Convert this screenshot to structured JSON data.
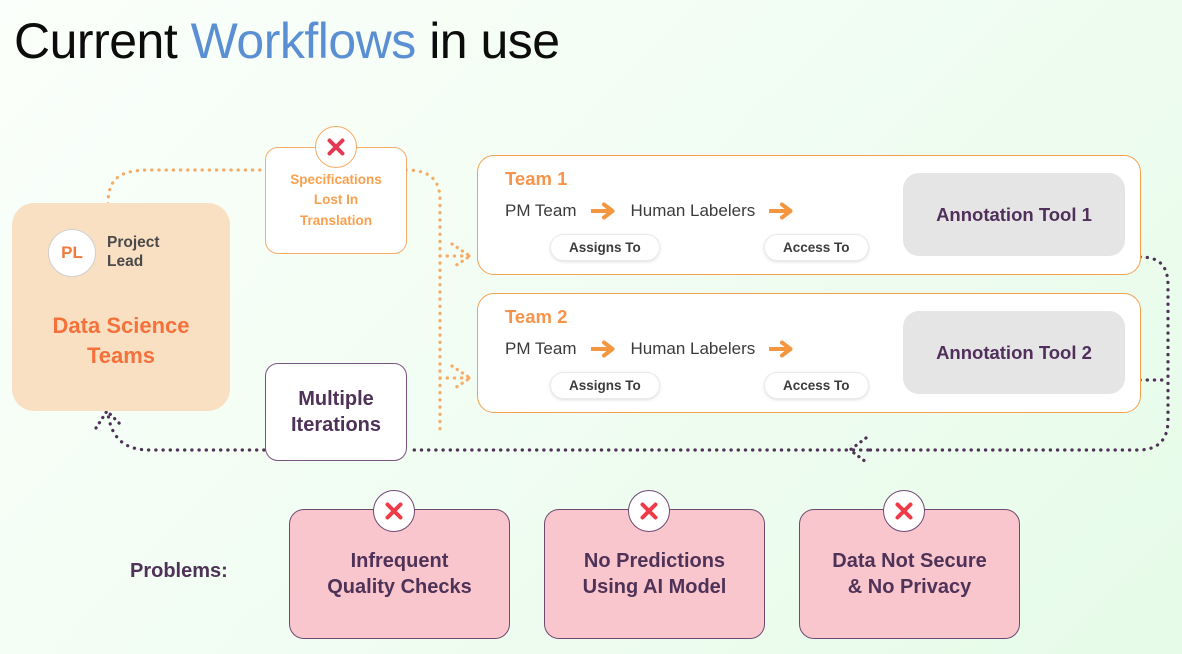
{
  "slide": {
    "title_prefix": "Current ",
    "title_highlight": "Workflows",
    "title_suffix": " in use",
    "highlight_color": "#5b8fd4"
  },
  "data_science": {
    "avatar_initials": "PL",
    "avatar_role": "Project\nLead",
    "avatar_role_line1": "Project",
    "avatar_role_line2": "Lead",
    "title_line1": "Data Science",
    "title_line2": "Teams",
    "box_color": "#fae0c3",
    "text_color": "#f4713c"
  },
  "spec_note": {
    "line1": "Specifications",
    "line2": "Lost In",
    "line3": "Translation",
    "icon": "x-icon",
    "text_color": "#f9a04f",
    "border_color": "#f6ac67"
  },
  "iterations_note": {
    "line1": "Multiple",
    "line2": "Iterations",
    "text_color": "#4f3257",
    "border_color": "#7a5480"
  },
  "teams": [
    {
      "name": "Team 1",
      "source": "PM Team",
      "target": "Human Labelers",
      "source_pill": "Assigns To",
      "target_pill": "Access To",
      "tool": "Annotation Tool 1"
    },
    {
      "name": "Team 2",
      "source": "PM Team",
      "target": "Human Labelers",
      "source_pill": "Assigns To",
      "target_pill": "Access To",
      "tool": "Annotation Tool 2"
    }
  ],
  "problems": {
    "label": "Problems:",
    "items": [
      {
        "line1": "Infrequent",
        "line2": "Quality Checks",
        "icon": "x-icon"
      },
      {
        "line1": "No Predictions",
        "line2": "Using AI Model",
        "icon": "x-icon"
      },
      {
        "line1": "Data Not Secure",
        "line2": "& No Privacy",
        "icon": "x-icon"
      }
    ],
    "card_color": "#f9c6ce",
    "border_color": "#6d4a72",
    "text_color": "#4f3257"
  },
  "connectors": {
    "outbound_color": "#f6ac67",
    "return_color": "#4f3257"
  }
}
